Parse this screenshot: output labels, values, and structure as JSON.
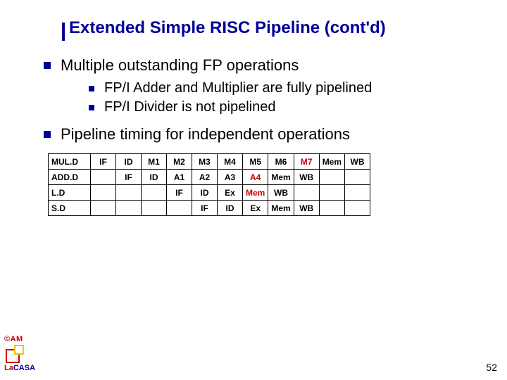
{
  "title": "Extended Simple RISC Pipeline (cont'd)",
  "bullets": [
    {
      "text": "Multiple outstanding FP operations",
      "sub": [
        "FP/I Adder and Multiplier are fully pipelined",
        "FP/I Divider is not pipelined"
      ]
    },
    {
      "text": "Pipeline timing for independent operations",
      "sub": []
    }
  ],
  "table": {
    "rows": [
      {
        "label": "MUL.D",
        "stages": [
          "IF",
          "ID",
          "M1",
          "M2",
          "M3",
          "M4",
          "M5",
          "M6",
          "M7",
          "Mem",
          "WB"
        ],
        "hl": [
          8
        ]
      },
      {
        "label": "ADD.D",
        "stages": [
          "",
          "IF",
          "ID",
          "A1",
          "A2",
          "A3",
          "A4",
          "Mem",
          "WB",
          "",
          ""
        ],
        "hl": [
          6
        ]
      },
      {
        "label": "L.D",
        "stages": [
          "",
          "",
          "",
          "IF",
          "ID",
          "Ex",
          "Mem",
          "WB",
          "",
          "",
          ""
        ],
        "hl": [
          6
        ]
      },
      {
        "label": "S.D",
        "stages": [
          "",
          "",
          "",
          "",
          "IF",
          "ID",
          "Ex",
          "Mem",
          "WB",
          "",
          ""
        ],
        "hl": []
      }
    ]
  },
  "footer": {
    "copyright": "©AM",
    "lacasa_parts": [
      "La",
      "CASA"
    ]
  },
  "pageNumber": "52"
}
